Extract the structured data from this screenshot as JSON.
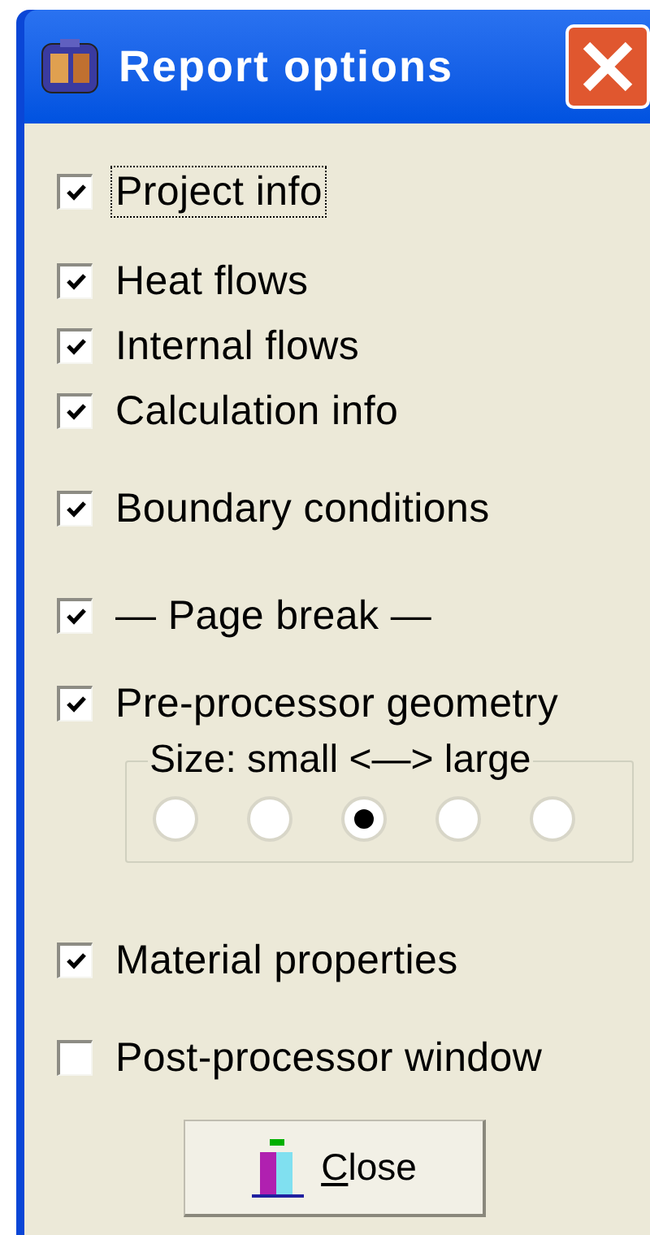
{
  "window": {
    "title": "Report options"
  },
  "items": [
    {
      "kind": "checkbox",
      "label": "Project info",
      "checked": true,
      "focused": true
    },
    {
      "kind": "checkbox",
      "label": "Heat flows",
      "checked": true,
      "focused": false
    },
    {
      "kind": "checkbox",
      "label": "Internal flows",
      "checked": true,
      "focused": false
    },
    {
      "kind": "checkbox",
      "label": "Calculation info",
      "checked": true,
      "focused": false
    },
    {
      "kind": "checkbox",
      "label": "Boundary conditions",
      "checked": true,
      "focused": false
    },
    {
      "kind": "checkbox",
      "label": "— Page break —",
      "checked": true,
      "focused": false
    },
    {
      "kind": "checkbox",
      "label": "Pre-processor geometry",
      "checked": true,
      "focused": false
    },
    {
      "kind": "radio_group",
      "label": "Size: small <—> large",
      "options": [
        {
          "selected": false
        },
        {
          "selected": false
        },
        {
          "selected": true
        },
        {
          "selected": false
        },
        {
          "selected": false
        }
      ]
    },
    {
      "kind": "checkbox",
      "label": "Material properties",
      "checked": true,
      "focused": false
    },
    {
      "kind": "checkbox",
      "label": "Post-processor window",
      "checked": false,
      "focused": false
    }
  ],
  "close_button": {
    "label": "Close",
    "accelerator_underlined": true
  }
}
